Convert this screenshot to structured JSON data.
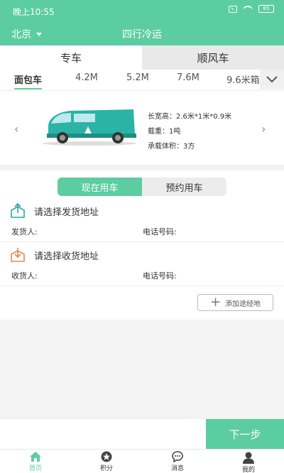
{
  "status_bar": {
    "time": "晚上10:55",
    "battery": "85"
  },
  "nav": {
    "city": "北京",
    "title": "四行冷运"
  },
  "main_tabs": [
    {
      "label": "专车",
      "active": true
    },
    {
      "label": "顺风车",
      "active": false
    }
  ],
  "vehicle_tabs": [
    {
      "label": "面包车",
      "active": true
    },
    {
      "label": "4.2M"
    },
    {
      "label": "5.2M"
    },
    {
      "label": "7.6M"
    },
    {
      "label": "9.6米箱"
    }
  ],
  "vehicle": {
    "dimensions": "长宽高：2.6米*1米*0.9米",
    "load": "载重：1吨",
    "volume": "承载体积：3方",
    "color": "#2bb3a6"
  },
  "order": {
    "modes": [
      {
        "label": "现在用车",
        "active": true
      },
      {
        "label": "预约用车",
        "active": false
      }
    ],
    "sender": {
      "address_prompt": "请选择发货地址",
      "name_label": "发货人:",
      "phone_label": "电话号码:"
    },
    "receiver": {
      "address_prompt": "请选择收货地址",
      "name_label": "收货人:",
      "phone_label": "电话号码:"
    },
    "waypoint_label": "添加途经地"
  },
  "next_label": "下一步",
  "bottom_nav": [
    {
      "label": "首页",
      "icon": "home-icon",
      "active": true
    },
    {
      "label": "积分",
      "icon": "star-icon"
    },
    {
      "label": "消息",
      "icon": "message-icon"
    },
    {
      "label": "我的",
      "icon": "user-icon"
    }
  ],
  "colors": {
    "accent": "#5ccda0",
    "sender_icon": "#2aa8a0",
    "receiver_icon": "#e08a4a"
  }
}
